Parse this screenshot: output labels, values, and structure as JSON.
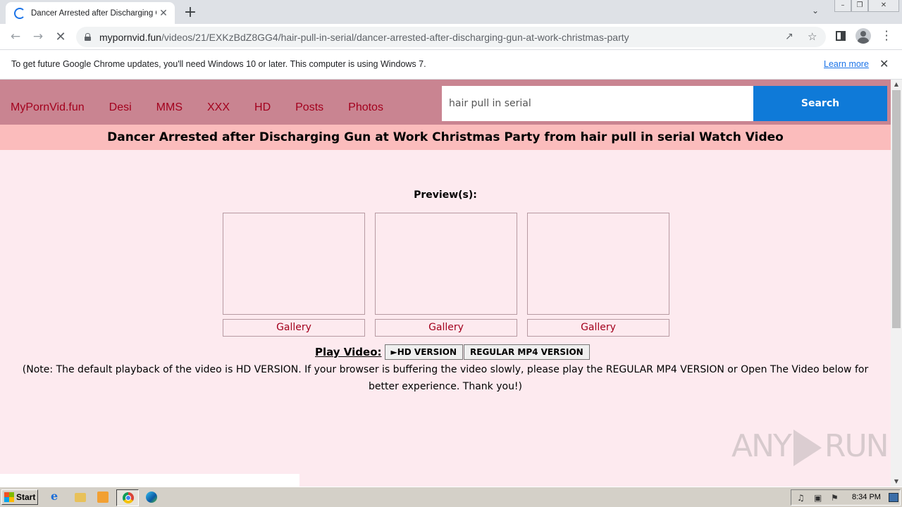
{
  "browser": {
    "tab_title": "Dancer Arrested after Discharging Gun at Work Christmas Party",
    "new_tab_glyph": "+",
    "url_host": "mypornvid.fun",
    "url_path": "/videos/21/EXKzBdZ8GG4/hair-pull-in-serial/dancer-arrested-after-discharging-gun-at-work-christmas-party"
  },
  "infobar": {
    "message": "To get future Google Chrome updates, you'll need Windows 10 or later. This computer is using Windows 7.",
    "link": "Learn more"
  },
  "site": {
    "nav": [
      "MyPornVid.fun",
      "Desi",
      "MMS",
      "XXX",
      "HD",
      "Posts",
      "Photos"
    ],
    "search_value": "hair pull in serial",
    "search_button": "Search",
    "page_title": "Dancer Arrested after Discharging Gun at Work Christmas Party from hair pull in serial Watch Video",
    "preview_label": "Preview(s):",
    "gallery_labels": [
      "Gallery",
      "Gallery",
      "Gallery"
    ],
    "play_label": "Play Video:",
    "hd_button": "►HD VERSION",
    "mp4_button": "REGULAR MP4 VERSION",
    "note": "(Note: The default playback of the video is HD VERSION. If your browser is buffering the video slowly, please play the REGULAR MP4 VERSION or Open The Video below for better experience. Thank you!)"
  },
  "watermark": {
    "left": "ANY",
    "right": "RUN"
  },
  "taskbar": {
    "start_label": "Start",
    "clock": "8:34 PM"
  },
  "colors": {
    "header_bg": "#c98491",
    "title_bar_bg": "#fbbcbc",
    "page_bg": "#fdeaef",
    "nav_link": "#a3001d",
    "search_button_bg": "#0f7ad8"
  }
}
